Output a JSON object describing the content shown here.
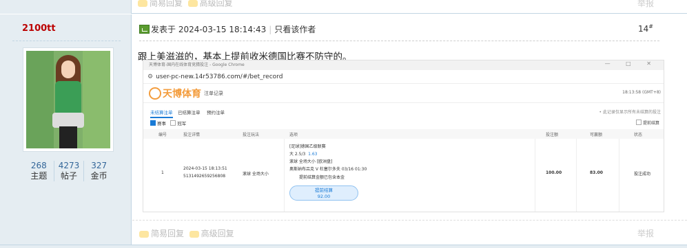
{
  "prev_post": {
    "quick_reply": "简易回复",
    "adv_reply": "高级回复",
    "report": "举报"
  },
  "author": {
    "name": "2100tt",
    "stats": [
      {
        "num": "268",
        "label": "主题"
      },
      {
        "num": "4273",
        "label": "帖子"
      },
      {
        "num": "327",
        "label": "金币"
      }
    ]
  },
  "post": {
    "posted_at": "发表于 2024-03-15 18:14:43",
    "only_author": "只看该作者",
    "floor": "14",
    "floor_sup": "#",
    "text": "跟上美滋滋的，基本上提前收米德国比赛不防守的。"
  },
  "screenshot": {
    "window_title": "天博体育-国内在线体育竞猜投注 - Google Chrome",
    "url": "user-pc-new.14r53786.com/#/bet_record",
    "logo": "天博体育",
    "nav": "注单记录",
    "clock": "18:13:58 (GMT+8)",
    "tabs": [
      "未结算注单",
      "已结算注单",
      "预约注单"
    ],
    "tab_note": "• 此记录仅显示所有未结算的投注",
    "filters": [
      "赛事",
      "冠军"
    ],
    "early_cashout": "提前结算",
    "headers": [
      "编号",
      "投注详情",
      "投注玩法",
      "选项",
      "投注额",
      "可赢额",
      "状态"
    ],
    "row": {
      "index": "1",
      "time": "2024-03-15 18:13:51",
      "order_no": "5131492659256808",
      "play": "滚球 全场大小",
      "league": "[足球]德国乙级联赛",
      "pick": "大 2.5/3",
      "odds": "1.63",
      "market": "滚球  全场大小  [欧洲盘]",
      "match": "奥斯纳布吕克 V 杜塞尔多夫   03/16 01:30",
      "note": "提前结算金额已包含本金",
      "cashout_label": "提前结算",
      "cashout_amount": "92.00",
      "stake": "100.00",
      "win": "83.00",
      "status": "投注成功"
    }
  },
  "next_post": {
    "quick_reply": "简易回复",
    "adv_reply": "高级回复",
    "report": "举报"
  }
}
